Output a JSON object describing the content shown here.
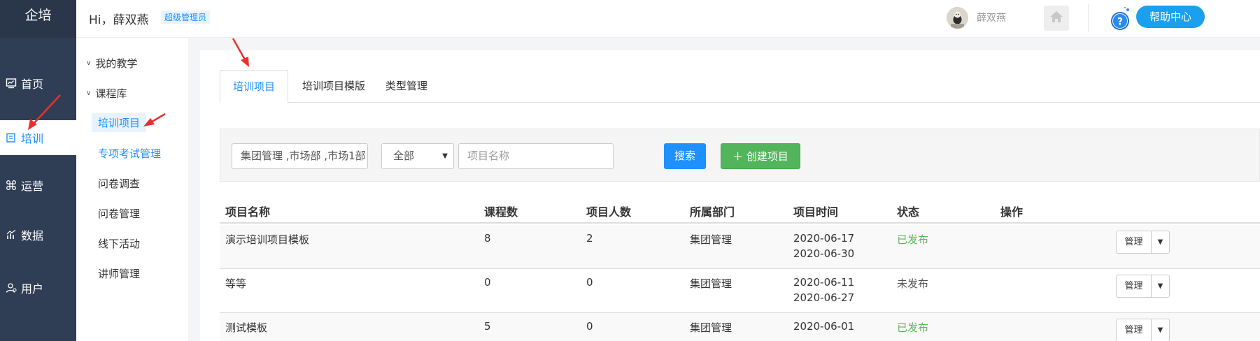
{
  "app": {
    "brand": "企培"
  },
  "header": {
    "greeting": "Hi，薛双燕",
    "role": "超级管理员",
    "user_name": "薛双燕",
    "help_label": "帮助中心"
  },
  "rail": {
    "items": [
      {
        "label": "首页",
        "icon": "dashboard-icon"
      },
      {
        "label": "培训",
        "icon": "book-icon",
        "active": true
      },
      {
        "label": "运营",
        "icon": "command-icon"
      },
      {
        "label": "数据",
        "icon": "bar-chart-icon"
      },
      {
        "label": "用户",
        "icon": "user-icon"
      }
    ]
  },
  "subnav": {
    "groups": [
      {
        "label": "我的教学"
      },
      {
        "label": "课程库"
      }
    ],
    "items": [
      {
        "label": "培训项目",
        "active": true
      },
      {
        "label": "专项考试管理"
      },
      {
        "label": "问卷调查"
      },
      {
        "label": "问卷管理"
      },
      {
        "label": "线下活动"
      },
      {
        "label": "讲师管理"
      }
    ]
  },
  "tabs": [
    {
      "label": "培训项目",
      "active": true
    },
    {
      "label": "培训项目模版"
    },
    {
      "label": "类型管理"
    }
  ],
  "filter": {
    "dept_value": "集团管理 ,市场部 ,市场1部 ,",
    "status_value": "全部",
    "name_placeholder": "项目名称",
    "search_label": "搜索",
    "create_label": "创建项目"
  },
  "table": {
    "headers": [
      "项目名称",
      "课程数",
      "项目人数",
      "所属部门",
      "项目时间",
      "状态",
      "操作"
    ],
    "rows": [
      {
        "name": "演示培训项目模板",
        "courses": "8",
        "people": "2",
        "dept": "集团管理",
        "start": "2020-06-17",
        "end": "2020-06-30",
        "status": "已发布",
        "op": "管理"
      },
      {
        "name": "等等",
        "courses": "0",
        "people": "0",
        "dept": "集团管理",
        "start": "2020-06-11",
        "end": "2020-06-27",
        "status": "未发布",
        "op": "管理"
      },
      {
        "name": "测试模板",
        "courses": "5",
        "people": "0",
        "dept": "集团管理",
        "start": "2020-06-01",
        "end": "",
        "status": "已发布",
        "op": "管理"
      }
    ]
  },
  "colors": {
    "rail_bg": "#2f3e55",
    "accent": "#1e90ff",
    "published": "#5cb85c",
    "create_button": "#52b45b",
    "annotation_arrow": "#e8312e"
  }
}
